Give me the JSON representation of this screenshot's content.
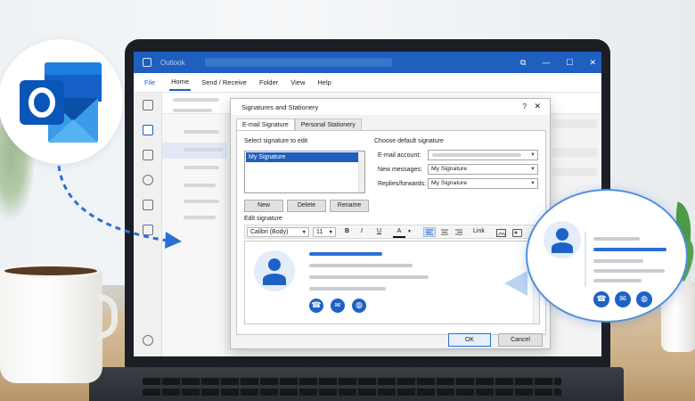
{
  "outlook": {
    "window_title": "Outlook",
    "window_buttons": [
      "⧉",
      "—",
      "☐",
      "✕"
    ],
    "ribbon_tabs": [
      "File",
      "Home",
      "Send / Receive",
      "Folder",
      "View",
      "Help"
    ],
    "active_tab": "Home"
  },
  "dialog": {
    "title": "Signatures and Stationery",
    "help": "?",
    "close": "✕",
    "tabs": [
      "E-mail Signature",
      "Personal Stationery"
    ],
    "select_label": "Select signature to edit",
    "signatures": [
      "My Signature"
    ],
    "buttons": {
      "new": "New",
      "delete": "Delete",
      "rename": "Rename"
    },
    "default_label": "Choose default signature",
    "email_account_label": "E-mail account:",
    "new_messages_label": "New messages:",
    "new_messages_value": "My Signature",
    "replies_label": "Replies/forwards:",
    "replies_value": "My Signature",
    "edit_label": "Edit signature",
    "font": "Calibri (Body)",
    "font_size": "11",
    "toolbar": {
      "bold": "B",
      "italic": "I",
      "underline": "U",
      "font_color": "A",
      "link": "Link"
    },
    "ok": "OK",
    "cancel": "Cancel"
  },
  "callout_icons": [
    "☎",
    "✉",
    "◍"
  ],
  "colors": {
    "outlook_blue": "#1f5fbf",
    "accent": "#2a6fd6",
    "callout_border": "#4f8fe0"
  }
}
